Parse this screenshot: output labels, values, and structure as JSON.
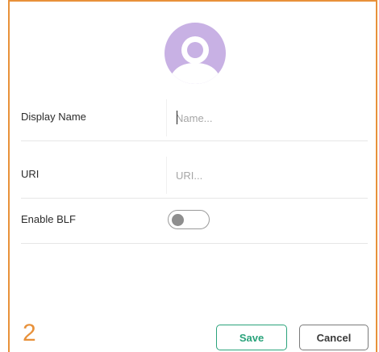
{
  "form": {
    "display_name": {
      "label": "Display Name",
      "value": "",
      "placeholder": "Name..."
    },
    "uri": {
      "label": "URI",
      "value": "",
      "placeholder": "URI..."
    },
    "enable_blf": {
      "label": "Enable BLF",
      "checked": false
    }
  },
  "annotation": {
    "step": "2"
  },
  "actions": {
    "save_label": "Save",
    "cancel_label": "Cancel"
  },
  "colors": {
    "accent_border": "#e8913a",
    "avatar": "#c8b1e4",
    "save": "#2aa37b"
  },
  "icons": {
    "avatar": "user-avatar-icon"
  }
}
